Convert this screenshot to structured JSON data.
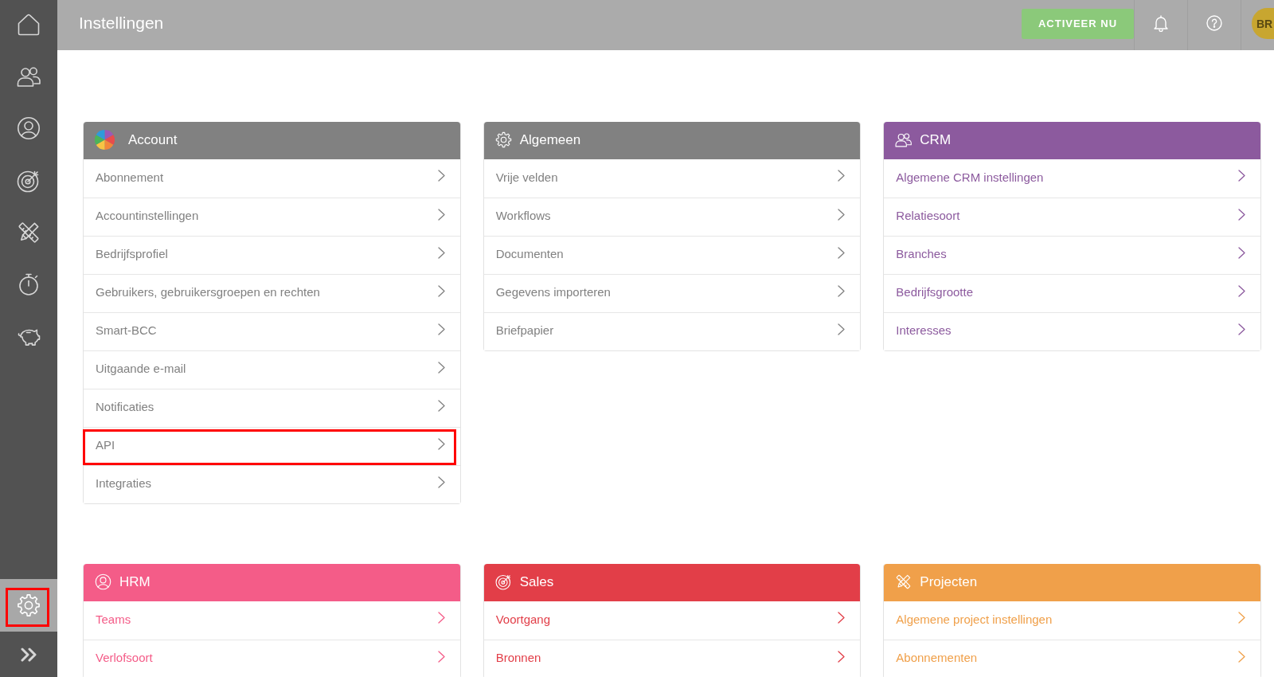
{
  "sidebar": {
    "items": [
      {
        "selected": false,
        "highlighted": false
      },
      {
        "selected": false,
        "highlighted": false
      },
      {
        "selected": false,
        "highlighted": false
      },
      {
        "selected": false,
        "highlighted": false
      },
      {
        "selected": false,
        "highlighted": false
      },
      {
        "selected": false,
        "highlighted": false
      },
      {
        "selected": false,
        "highlighted": false
      }
    ],
    "bottom_items": [
      {
        "selected": true,
        "highlighted": true
      }
    ]
  },
  "top_bar": {
    "title": "Instellingen",
    "activate_button": "ACTIVEER NU",
    "avatar": "BR"
  },
  "sections": [
    {
      "title": "Account",
      "color": "#818181",
      "items": [
        {
          "label": "Abonnement",
          "highlighted": false
        },
        {
          "label": "Accountinstellingen",
          "highlighted": false
        },
        {
          "label": "Bedrijfsprofiel",
          "highlighted": false
        },
        {
          "label": "Gebruikers, gebruikersgroepen en rechten",
          "highlighted": false
        },
        {
          "label": "Smart-BCC",
          "highlighted": false
        },
        {
          "label": "Uitgaande e-mail",
          "highlighted": false
        },
        {
          "label": "Notificaties",
          "highlighted": false
        },
        {
          "label": "API",
          "highlighted": true
        },
        {
          "label": "Integraties",
          "highlighted": false
        }
      ]
    },
    {
      "title": "Algemeen",
      "color": "#818181",
      "items": [
        {
          "label": "Vrije velden",
          "highlighted": false
        },
        {
          "label": "Workflows",
          "highlighted": false
        },
        {
          "label": "Documenten",
          "highlighted": false
        },
        {
          "label": "Gegevens importeren",
          "highlighted": false
        },
        {
          "label": "Briefpapier",
          "highlighted": false
        }
      ]
    },
    {
      "title": "CRM",
      "color": "#8c5a9e",
      "items": [
        {
          "label": "Algemene CRM instellingen",
          "highlighted": false
        },
        {
          "label": "Relatiesoort",
          "highlighted": false
        },
        {
          "label": "Branches",
          "highlighted": false
        },
        {
          "label": "Bedrijfsgrootte",
          "highlighted": false
        },
        {
          "label": "Interesses",
          "highlighted": false
        }
      ]
    },
    {
      "title": "HRM",
      "color": "#f45c88",
      "items": [
        {
          "label": "Teams",
          "highlighted": false
        },
        {
          "label": "Verlofsoort",
          "highlighted": false
        }
      ]
    },
    {
      "title": "Sales",
      "color": "#e23e48",
      "items": [
        {
          "label": "Voortgang",
          "highlighted": false
        },
        {
          "label": "Bronnen",
          "highlighted": false
        }
      ]
    },
    {
      "title": "Projecten",
      "color": "#f0a04a",
      "items": [
        {
          "label": "Algemene project instellingen",
          "highlighted": false
        },
        {
          "label": "Abonnementen",
          "highlighted": false
        }
      ]
    }
  ]
}
